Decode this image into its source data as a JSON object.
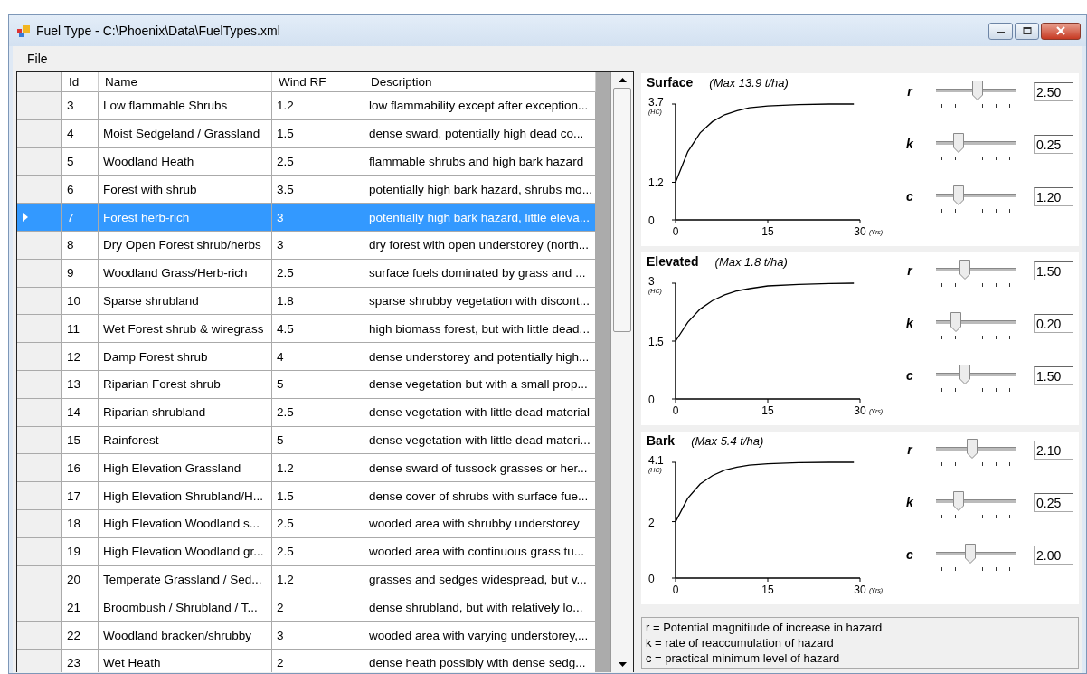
{
  "window": {
    "title": "Fuel Type - C:\\Phoenix\\Data\\FuelTypes.xml"
  },
  "menu": [
    "File"
  ],
  "table": {
    "columns": [
      "Id",
      "Name",
      "Wind RF",
      "Description"
    ],
    "rows": [
      {
        "id": "3",
        "name": "Low flammable Shrubs",
        "wind_rf": "1.2",
        "description": "low flammability except after exception...",
        "selected": false
      },
      {
        "id": "4",
        "name": "Moist Sedgeland / Grassland",
        "wind_rf": "1.5",
        "description": "dense sward, potentially high dead co...",
        "selected": false
      },
      {
        "id": "5",
        "name": "Woodland Heath",
        "wind_rf": "2.5",
        "description": "flammable shrubs and high bark hazard",
        "selected": false
      },
      {
        "id": "6",
        "name": "Forest with shrub",
        "wind_rf": "3.5",
        "description": "potentially high bark hazard, shrubs mo...",
        "selected": false
      },
      {
        "id": "7",
        "name": "Forest herb-rich",
        "wind_rf": "3",
        "description": "potentially high bark hazard, little eleva...",
        "selected": true
      },
      {
        "id": "8",
        "name": "Dry Open Forest shrub/herbs",
        "wind_rf": "3",
        "description": "dry forest with open understorey (north...",
        "selected": false
      },
      {
        "id": "9",
        "name": "Woodland Grass/Herb-rich",
        "wind_rf": "2.5",
        "description": "surface fuels dominated by grass and ...",
        "selected": false
      },
      {
        "id": "10",
        "name": "Sparse shrubland",
        "wind_rf": "1.8",
        "description": "sparse shrubby vegetation with discont...",
        "selected": false
      },
      {
        "id": "11",
        "name": "Wet Forest shrub & wiregrass",
        "wind_rf": "4.5",
        "description": "high biomass forest, but with little dead...",
        "selected": false
      },
      {
        "id": "12",
        "name": "Damp Forest  shrub",
        "wind_rf": "4",
        "description": "dense understorey and potentially high...",
        "selected": false
      },
      {
        "id": "13",
        "name": "Riparian Forest shrub",
        "wind_rf": "5",
        "description": "dense vegetation but with a small prop...",
        "selected": false
      },
      {
        "id": "14",
        "name": "Riparian shrubland",
        "wind_rf": "2.5",
        "description": "dense vegetation with little dead material",
        "selected": false
      },
      {
        "id": "15",
        "name": "Rainforest",
        "wind_rf": "5",
        "description": "dense vegetation with little dead materi...",
        "selected": false
      },
      {
        "id": "16",
        "name": "High Elevation Grassland",
        "wind_rf": "1.2",
        "description": "dense sward of tussock grasses or her...",
        "selected": false
      },
      {
        "id": "17",
        "name": "High Elevation Shrubland/H...",
        "wind_rf": "1.5",
        "description": "dense cover of shrubs with surface fue...",
        "selected": false
      },
      {
        "id": "18",
        "name": "High Elevation Woodland s...",
        "wind_rf": "2.5",
        "description": "wooded area with shrubby understorey",
        "selected": false
      },
      {
        "id": "19",
        "name": "High Elevation Woodland gr...",
        "wind_rf": "2.5",
        "description": "wooded area with continuous grass tu...",
        "selected": false
      },
      {
        "id": "20",
        "name": "Temperate Grassland / Sed...",
        "wind_rf": "1.2",
        "description": "grasses and sedges widespread, but v...",
        "selected": false
      },
      {
        "id": "21",
        "name": "Broombush / Shrubland / T...",
        "wind_rf": "2",
        "description": "dense shrubland, but with relatively lo...",
        "selected": false
      },
      {
        "id": "22",
        "name": "Woodland bracken/shrubby",
        "wind_rf": "3",
        "description": "wooded area with varying understorey,...",
        "selected": false
      },
      {
        "id": "23",
        "name": "Wet Heath",
        "wind_rf": "2",
        "description": "dense heath possibly with dense sedg...",
        "selected": false
      }
    ]
  },
  "layers": [
    {
      "title": "Surface",
      "max": "(Max 13.9 t/ha)",
      "y_unit": "(HC)",
      "x_unit": "(Yrs)",
      "chart_data": {
        "type": "line",
        "x": [
          0,
          2,
          4,
          6,
          8,
          10,
          12,
          15,
          20,
          25,
          29
        ],
        "series": [
          {
            "color": "#000000",
            "values": [
              1.2,
              2.18,
              2.78,
              3.14,
              3.36,
              3.49,
              3.58,
              3.64,
              3.68,
              3.7,
              3.7
            ]
          }
        ],
        "xlim": [
          0,
          30
        ],
        "ylim": [
          0,
          3.7
        ],
        "xticks": [
          0,
          15,
          30
        ],
        "yticks": [
          0,
          1.2,
          3.7
        ]
      },
      "params": [
        {
          "label": "r",
          "level": 0.52,
          "value": "2.50"
        },
        {
          "label": "k",
          "level": 0.28,
          "value": "0.25"
        },
        {
          "label": "c",
          "level": 0.28,
          "value": "1.20"
        }
      ]
    },
    {
      "title": "Elevated",
      "max": "(Max 1.8 t/ha)",
      "y_unit": "(HC)",
      "x_unit": "(Yrs)",
      "chart_data": {
        "type": "line",
        "x": [
          0,
          2,
          4,
          6,
          8,
          10,
          12,
          15,
          20,
          25,
          29
        ],
        "series": [
          {
            "color": "#000000",
            "values": [
              1.5,
              1.99,
              2.33,
              2.55,
              2.7,
              2.8,
              2.86,
              2.93,
              2.97,
              2.99,
              3
            ]
          }
        ],
        "xlim": [
          0,
          30
        ],
        "ylim": [
          0,
          3
        ],
        "xticks": [
          0,
          15,
          30
        ],
        "yticks": [
          0,
          1.5,
          3
        ]
      },
      "params": [
        {
          "label": "r",
          "level": 0.36,
          "value": "1.50"
        },
        {
          "label": "k",
          "level": 0.25,
          "value": "0.20"
        },
        {
          "label": "c",
          "level": 0.36,
          "value": "1.50"
        }
      ]
    },
    {
      "title": "Bark",
      "max": "(Max 5.4 t/ha)",
      "y_unit": "(HC)",
      "x_unit": "(Yrs)",
      "chart_data": {
        "type": "line",
        "x": [
          0,
          2,
          4,
          6,
          8,
          10,
          12,
          15,
          20,
          25,
          29
        ],
        "series": [
          {
            "color": "#000000",
            "values": [
              2,
              2.83,
              3.33,
              3.63,
              3.82,
              3.93,
              4,
              4.05,
              4.09,
              4.1,
              4.1
            ]
          }
        ],
        "xlim": [
          0,
          30
        ],
        "ylim": [
          0,
          4.1
        ],
        "xticks": [
          0,
          15,
          30
        ],
        "yticks": [
          0,
          2,
          4.1
        ]
      },
      "params": [
        {
          "label": "r",
          "level": 0.45,
          "value": "2.10"
        },
        {
          "label": "k",
          "level": 0.28,
          "value": "0.25"
        },
        {
          "label": "c",
          "level": 0.43,
          "value": "2.00"
        }
      ]
    }
  ],
  "legend": [
    "r = Potential magnitiude of increase in hazard",
    "k = rate of reaccumulation of hazard",
    "c = practical minimum level of hazard"
  ]
}
